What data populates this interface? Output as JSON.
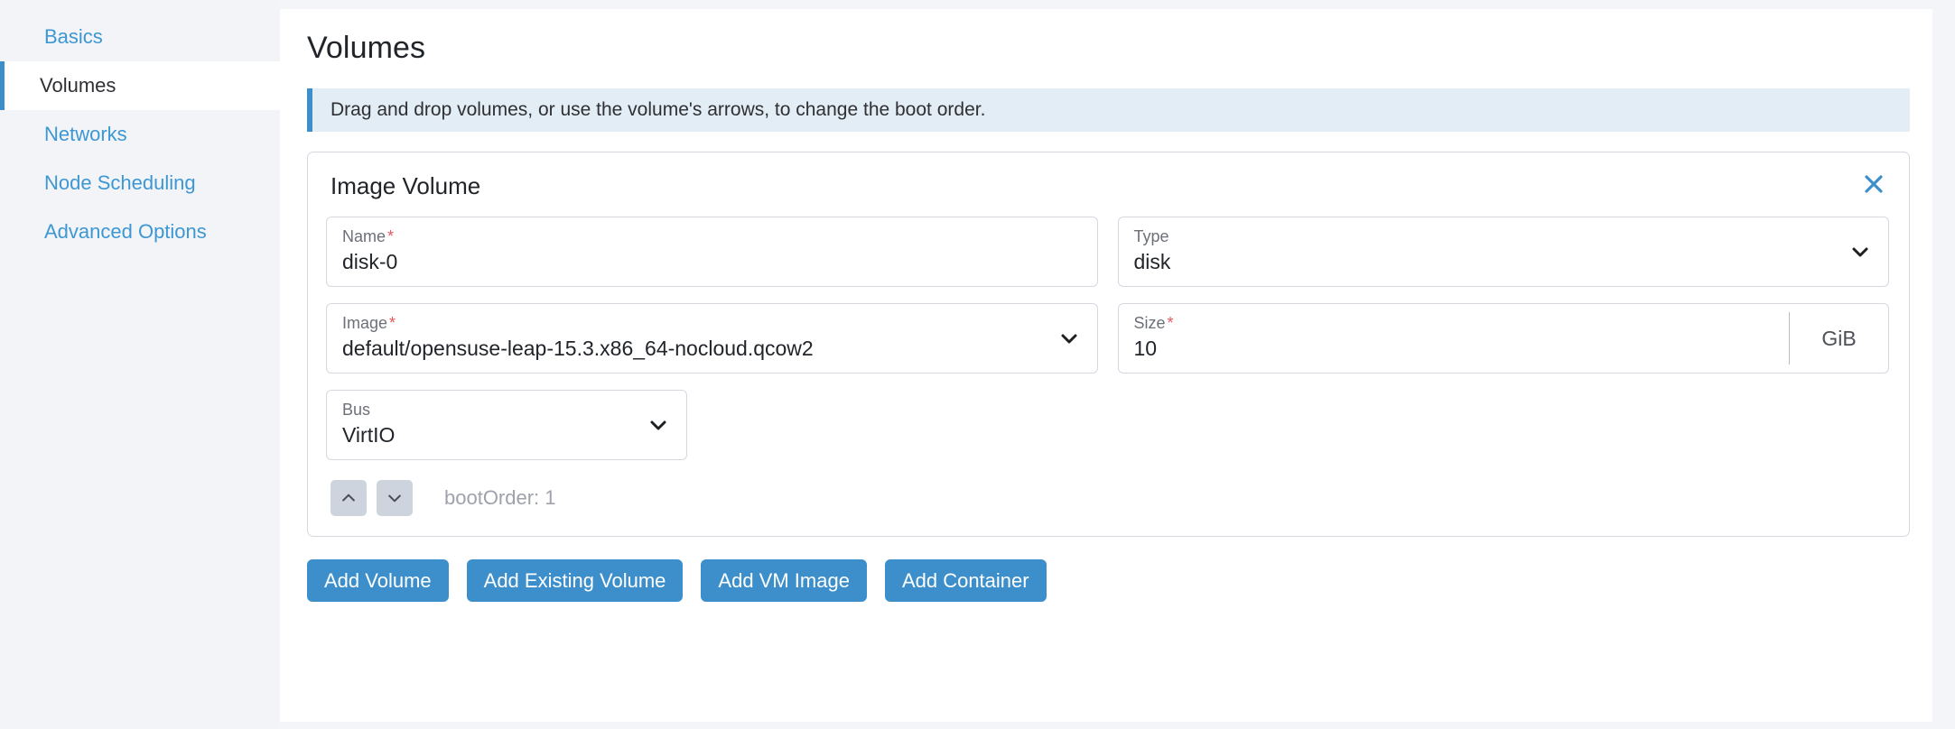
{
  "sidebar": {
    "items": [
      {
        "label": "Basics",
        "active": false
      },
      {
        "label": "Volumes",
        "active": true
      },
      {
        "label": "Networks",
        "active": false
      },
      {
        "label": "Node Scheduling",
        "active": false
      },
      {
        "label": "Advanced Options",
        "active": false
      }
    ]
  },
  "main": {
    "title": "Volumes",
    "banner": {
      "text": "Drag and drop volumes, or use the volume's arrows, to change the boot order."
    },
    "card": {
      "title": "Image Volume",
      "close_icon": "close-icon",
      "fields": {
        "name": {
          "label": "Name",
          "required": "*",
          "value": "disk-0"
        },
        "type": {
          "label": "Type",
          "value": "disk",
          "icon": "chevron-down-icon"
        },
        "image": {
          "label": "Image",
          "required": "*",
          "value": "default/opensuse-leap-15.3.x86_64-nocloud.qcow2",
          "icon": "chevron-down-icon"
        },
        "size": {
          "label": "Size",
          "required": "*",
          "value": "10",
          "unit": "GiB"
        },
        "bus": {
          "label": "Bus",
          "value": "VirtIO",
          "icon": "chevron-down-icon"
        }
      },
      "boot_order": {
        "up_icon": "chevron-up-icon",
        "down_icon": "chevron-down-icon",
        "text": "bootOrder: 1"
      }
    },
    "actions": [
      {
        "label": "Add Volume"
      },
      {
        "label": "Add Existing Volume"
      },
      {
        "label": "Add VM Image"
      },
      {
        "label": "Add Container"
      }
    ]
  },
  "colors": {
    "accent": "#3d8fcc",
    "link": "#3d97d3",
    "banner_bg": "#e2edf6",
    "required": "#e8565b",
    "muted": "#9fa2ab",
    "sidebar_bg": "#f2f4f8",
    "page_bg": "#f4f5f8"
  }
}
